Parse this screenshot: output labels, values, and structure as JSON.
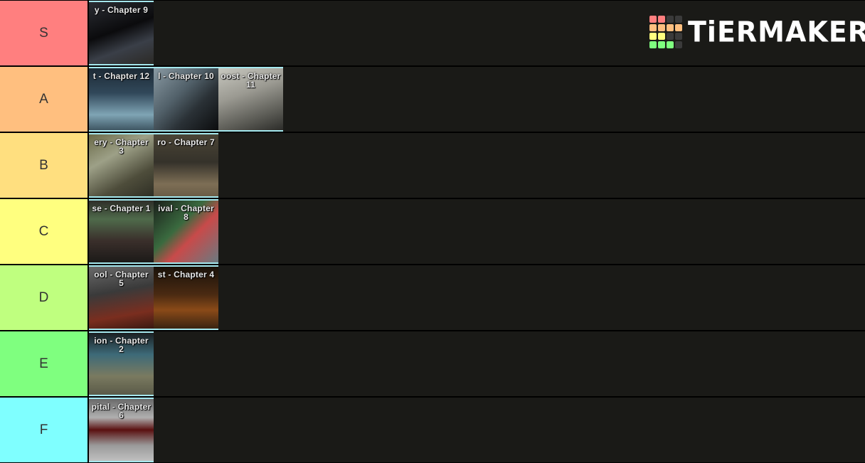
{
  "brand": {
    "name": "TiERMAKER",
    "grid_colors": [
      "#ff7f7f",
      "#ff7f7f",
      "#3a3a3a",
      "#3a3a3a",
      "#ffbf7f",
      "#ffbf7f",
      "#ffbf7f",
      "#ffbf7f",
      "#ffff7f",
      "#ffff7f",
      "#3a3a3a",
      "#3a3a3a",
      "#7fff7f",
      "#7fff7f",
      "#7fff7f",
      "#3a3a3a"
    ]
  },
  "tiers": [
    {
      "label": "S",
      "color": "#ff7f7f",
      "items": [
        {
          "caption": "y - Chapter 9",
          "caption2": "",
          "bg": "linear-gradient(160deg,#2a2d33 0%,#0b0b0d 45%,#3a3f48 70%,#2c2a26 100%)"
        }
      ]
    },
    {
      "label": "A",
      "color": "#ffbf7f",
      "items": [
        {
          "caption": "t - Chapter 12",
          "caption2": "",
          "bg": "linear-gradient(180deg,#1d2a35 0%,#31485a 40%,#7fa4b4 75%,#3e5663 100%)"
        },
        {
          "caption": "l - Chapter 10",
          "caption2": "",
          "bg": "linear-gradient(135deg,#8a9aa3 0%,#52616a 40%,#2a3136 65%,#0c0d0e 100%)"
        },
        {
          "caption": "oost - Chapter",
          "caption2": "11",
          "bg": "linear-gradient(160deg,#c8c8c0 0%,#9b9a92 40%,#5b5b55 75%,#2c2c29 100%)"
        }
      ]
    },
    {
      "label": "B",
      "color": "#ffdf7f",
      "items": [
        {
          "caption": "ery - Chapter",
          "caption2": "3",
          "bg": "linear-gradient(150deg,#6a6a48 0%,#9da087 35%,#4e4d3b 70%,#2f2f25 100%)"
        },
        {
          "caption": "ro - Chapter 7",
          "caption2": "",
          "bg": "linear-gradient(180deg,#4a4436 0%,#35322a 45%,#7d6e55 80%,#6a5d47 100%)"
        }
      ]
    },
    {
      "label": "C",
      "color": "#ffff7f",
      "items": [
        {
          "caption": "se - Chapter 1",
          "caption2": "",
          "bg": "linear-gradient(180deg,#2e2e28 0%,#4f6a4b 30%,#3a2f2b 65%,#1c1a18 100%)"
        },
        {
          "caption": "ival - Chapter",
          "caption2": "8",
          "bg": "linear-gradient(135deg,#1a1f1a 0%,#3a6a3f 40%,#c84a4a 60%,#6a7a80 100%)"
        }
      ]
    },
    {
      "label": "D",
      "color": "#bfff7f",
      "items": [
        {
          "caption": "ool - Chapter",
          "caption2": "5",
          "bg": "linear-gradient(170deg,#6a6a6a 0%,#3a3a3a 40%,#7a2e1f 75%,#3a1a12 100%)"
        },
        {
          "caption": "st - Chapter 4",
          "caption2": "",
          "bg": "linear-gradient(180deg,#1a120a 0%,#4a2a12 45%,#8a4a18 70%,#3a2412 100%)"
        }
      ]
    },
    {
      "label": "E",
      "color": "#7fff7f",
      "items": [
        {
          "caption": "ion - Chapter",
          "caption2": "2",
          "bg": "linear-gradient(180deg,#1a1f22 0%,#3d6a78 35%,#7a7a60 70%,#5a5a48 100%)"
        }
      ]
    },
    {
      "label": "F",
      "color": "#7fffff",
      "items": [
        {
          "caption": "pital - Chapter",
          "caption2": "6",
          "bg": "linear-gradient(180deg,#6a6a6a 0%,#b0b0b0 30%,#5a1010 50%,#9a9a9a 75%,#c0c0c0 100%)"
        }
      ]
    }
  ]
}
